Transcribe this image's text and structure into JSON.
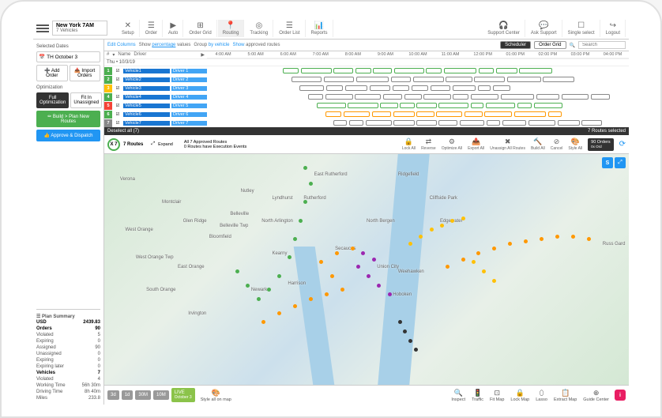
{
  "header": {
    "location": "New York 7AM",
    "vehicleCount": "7 Vehicles",
    "nav": [
      "Setup",
      "Order",
      "Auto",
      "Order Grid",
      "Routing",
      "Tracking",
      "Order List",
      "Reports"
    ],
    "navActive": 4,
    "right": [
      "Support Center",
      "Ask Support",
      "Single select",
      "Logout"
    ]
  },
  "sidebar": {
    "selectedDatesLabel": "Selected Dates",
    "date": "TH October 3",
    "addOrder": "Add Order",
    "importOrders": "Import Orders",
    "optimizationLabel": "Optimization",
    "fullOpt": "Full Optimization",
    "fitIn": "Fit In Unassigned",
    "build": "Build > Plan New Routes",
    "approve": "Approve & Dispatch",
    "planSummaryLabel": "Plan Summary",
    "summary": [
      {
        "k": "USD",
        "v": "2439.83",
        "b": true
      },
      {
        "k": "Orders",
        "v": "90",
        "b": true
      },
      {
        "k": "Violated",
        "v": "5"
      },
      {
        "k": "Expiring",
        "v": "0"
      },
      {
        "k": "Assigned",
        "v": "90"
      },
      {
        "k": "Unassigned",
        "v": "0"
      },
      {
        "k": "Expiring",
        "v": "0"
      },
      {
        "k": "Expiring later",
        "v": "0"
      },
      {
        "k": "Vehicles",
        "v": "7",
        "b": true
      },
      {
        "k": "Violated",
        "v": "4"
      },
      {
        "k": "Working Time",
        "v": "56h 30m"
      },
      {
        "k": "Driving Time",
        "v": "8h 40m"
      },
      {
        "k": "Miles",
        "v": "233.8"
      }
    ]
  },
  "filter": {
    "editCols": "Edit Columns",
    "showPct": "Show percentage values",
    "groupBy": "Group by vehicle",
    "showApproved": "Show approved routes",
    "scheduler": "Scheduler",
    "orderGrid": "Order Grid",
    "search": "Search",
    "dateRow": "Thu • 10/3/19",
    "timeSlots": [
      "4:00 AM",
      "5:00 AM",
      "6:00 AM",
      "7:00 AM",
      "8:00 AM",
      "9:00 AM",
      "10:00 AM",
      "11:00 AM",
      "12:00 PM",
      "01:00 PM",
      "02:00 PM",
      "03:00 PM",
      "04:00 PM"
    ],
    "sortCols": [
      "#",
      "Name",
      "Driver"
    ]
  },
  "routes": [
    {
      "n": "1",
      "c": "g",
      "v": "Vehicle1",
      "d": "Driver 1"
    },
    {
      "n": "2",
      "c": "g",
      "v": "Vehicle2",
      "d": "Driver 2"
    },
    {
      "n": "3",
      "c": "y",
      "v": "Vehicle3",
      "d": "Driver 3"
    },
    {
      "n": "4",
      "c": "g",
      "v": "Vehicle4",
      "d": "Driver 4"
    },
    {
      "n": "5",
      "c": "r",
      "v": "Vehicle5",
      "d": "Driver 5"
    },
    {
      "n": "6",
      "c": "g",
      "v": "Vehicle6",
      "d": "Driver 6"
    },
    {
      "n": "7",
      "c": "gr",
      "v": "Vehicle7",
      "d": "Driver 7"
    }
  ],
  "deselect": {
    "a": "Deselect all (7)",
    "b": "7 Routes selected"
  },
  "mapbar": {
    "routes": "7 Routes",
    "x7": "X 7",
    "approved": "All 7 Approved Routes",
    "events": "0 Routes have Execution Events",
    "expand": "Expand",
    "tools": [
      "Lock All",
      "Reverse",
      "Optimize All",
      "Export All",
      "Unassign All Routes",
      "Build All",
      "Cancel",
      "Style All"
    ],
    "orders": "90 Orders",
    "ordersSub": "0x Ord"
  },
  "map": {
    "places": [
      "Verona",
      "Montclair",
      "West Orange",
      "Glen Ridge",
      "Bloomfield",
      "Belleville",
      "Nutley",
      "North Arlington",
      "Kearny",
      "East Orange",
      "Newark",
      "Harrison",
      "Irvington",
      "South Orange",
      "West Orange Twp",
      "Belleville Twp",
      "Lyndhurst",
      "East Rutherford",
      "Rutherford",
      "North Bergen",
      "Union City",
      "Weehawken",
      "Hoboken",
      "Cliffside Park",
      "Ridgefield",
      "Edgewater",
      "Secaucus",
      "Russ Gard"
    ]
  },
  "bottom": {
    "zoom": [
      "3d",
      "1d",
      "30M",
      "10M"
    ],
    "live": "LIVE",
    "liveDate": "October 3",
    "styleAll": "Style all on map",
    "tools": [
      "Inspect",
      "Traffic",
      "Fit Map",
      "Lock Map",
      "Lasso",
      "Extract Map",
      "Guide Center"
    ]
  }
}
